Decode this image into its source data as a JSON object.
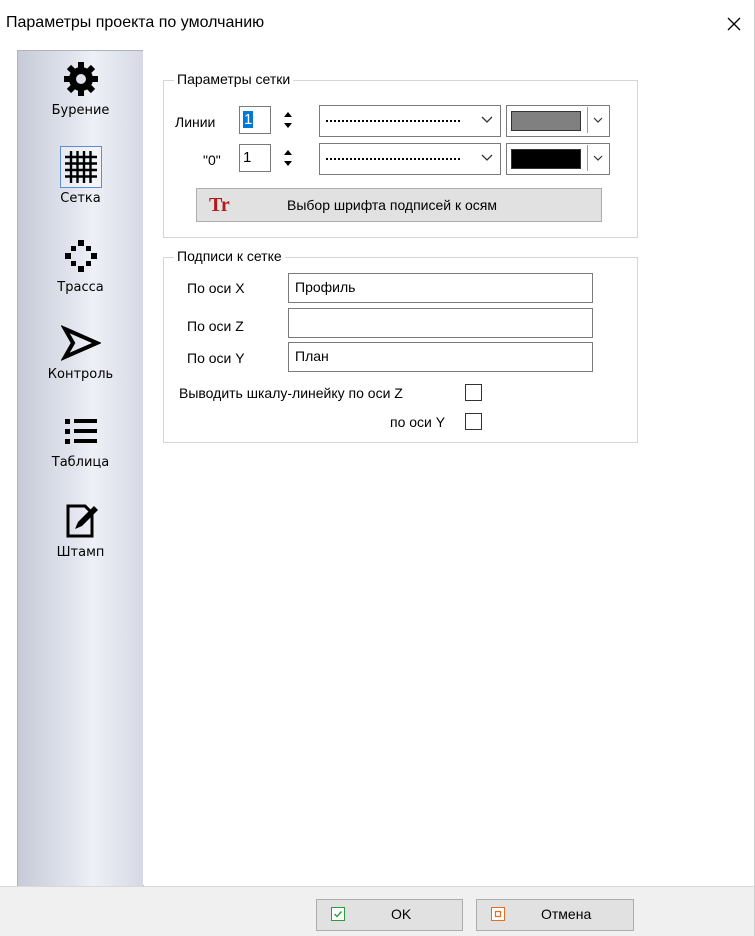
{
  "window": {
    "title": "Параметры проекта по умолчанию"
  },
  "sidebar": {
    "items": [
      {
        "label": "Бурение",
        "icon": "gear-icon"
      },
      {
        "label": "Сетка",
        "icon": "grid-icon",
        "selected": true
      },
      {
        "label": "Трасса",
        "icon": "route-icon"
      },
      {
        "label": "Контроль",
        "icon": "control-icon"
      },
      {
        "label": "Таблица",
        "icon": "list-icon"
      },
      {
        "label": "Штамп",
        "icon": "stamp-edit-icon"
      }
    ]
  },
  "grid_params": {
    "legend": "Параметры сетки",
    "lines_label": "Линии",
    "lines_value": "1",
    "zero_label": "\"0\"",
    "zero_value": "1",
    "lines_color": "#808080",
    "zero_color": "#000000",
    "font_button_icon": "Tr",
    "font_button": "Выбор шрифта подписей к осям"
  },
  "captions": {
    "legend": "Подписи к сетке",
    "x_label": "По оси X",
    "x_value": "Профиль",
    "z_label": "По оси Z",
    "z_value": "",
    "y_label": "По оси Y",
    "y_value": "План",
    "ruler_z_label": "Выводить шкалу-линейку по оси Z",
    "ruler_y_label": "по оси Y"
  },
  "footer": {
    "ok_label": "OK",
    "cancel_label": "Отмена"
  }
}
